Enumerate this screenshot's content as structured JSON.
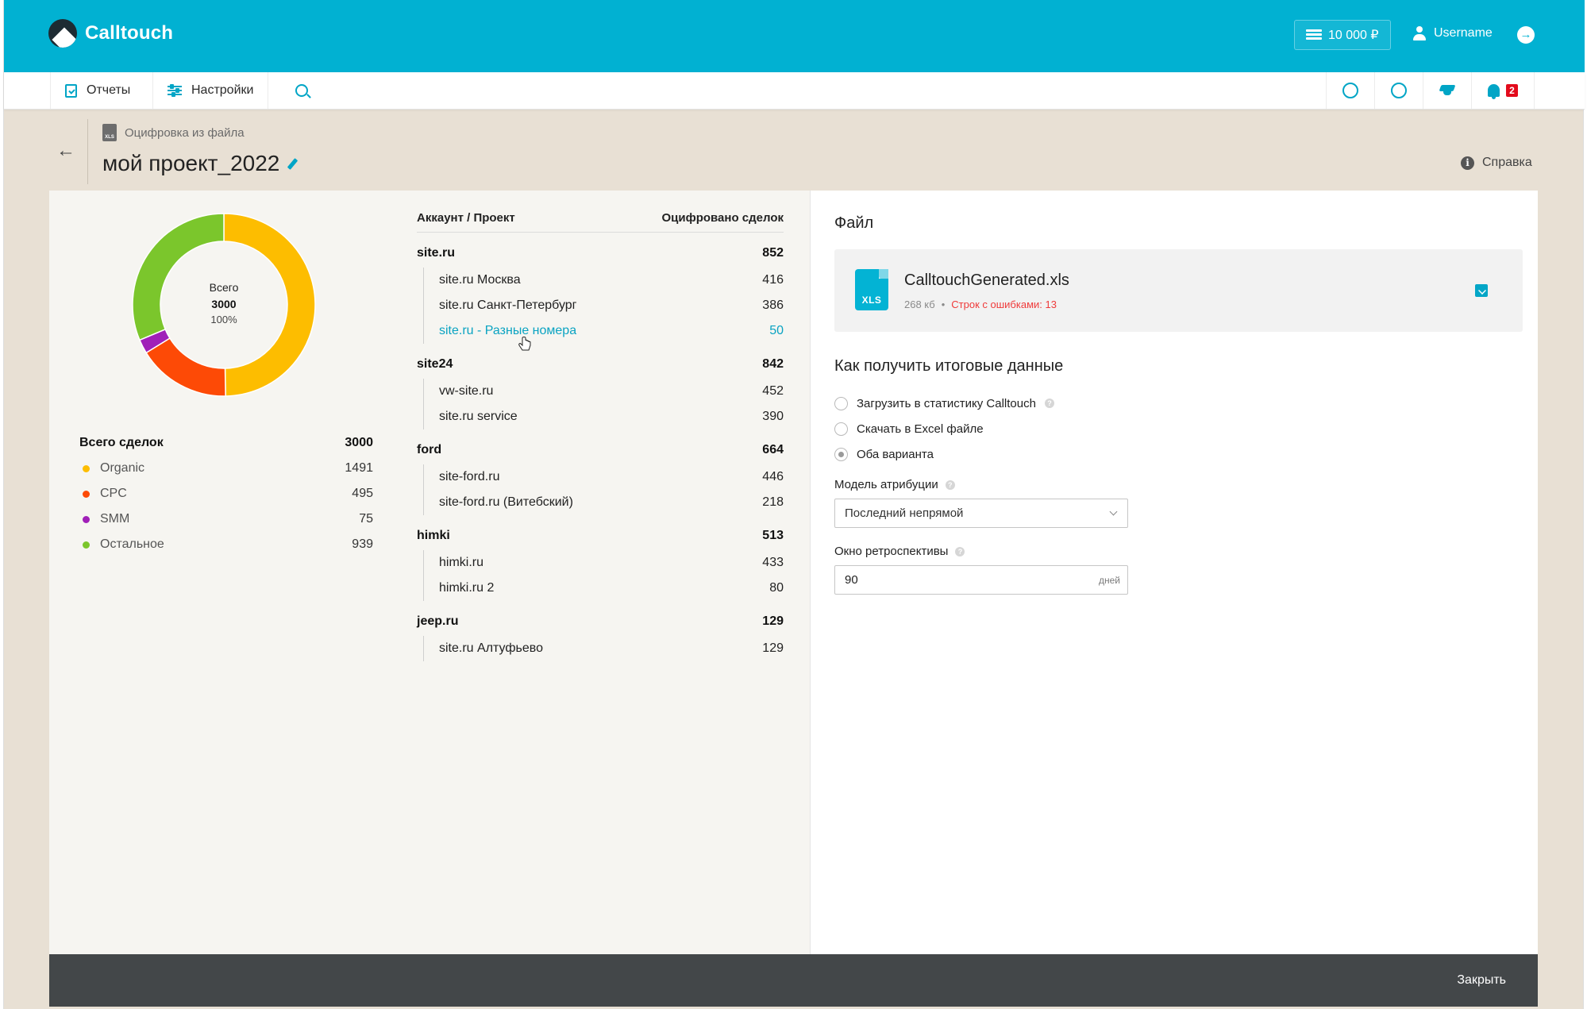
{
  "header": {
    "brand": "Calltouch",
    "balance": "10 000 ₽",
    "username": "Username"
  },
  "nav": {
    "reports": "Отчеты",
    "settings": "Настройки",
    "notifications_count": "2"
  },
  "page": {
    "breadcrumb": "Оцифровка из файла",
    "title": "мой проект_2022",
    "help": "Справка",
    "close": "Закрыть"
  },
  "chart_data": {
    "type": "pie",
    "categories": [
      "Organic",
      "CPC",
      "SMM",
      "Остальное"
    ],
    "values": [
      1491,
      495,
      75,
      939
    ],
    "colors": [
      "#fdbd00",
      "#fd4a06",
      "#a020b8",
      "#7bc62c"
    ],
    "center_label": "Всего",
    "center_value": "3000",
    "center_pct": "100%"
  },
  "summary": {
    "total_label": "Всего сделок",
    "total_value": "3000",
    "items": [
      {
        "label": "Organic",
        "value": "1491",
        "color": "#fdbd00"
      },
      {
        "label": "CPC",
        "value": "495",
        "color": "#fd4a06"
      },
      {
        "label": "SMM",
        "value": "75",
        "color": "#a020b8"
      },
      {
        "label": "Остальное",
        "value": "939",
        "color": "#7bc62c"
      }
    ]
  },
  "table": {
    "col_account": "Аккаунт / Проект",
    "col_count": "Оцифровано сделок",
    "groups": [
      {
        "name": "site.ru",
        "total": "852",
        "rows": [
          {
            "name": "site.ru Москва",
            "value": "416"
          },
          {
            "name": "site.ru Санкт-Петербург",
            "value": "386"
          },
          {
            "name": "site.ru - Разные номера",
            "value": "50"
          }
        ]
      },
      {
        "name": "site24",
        "total": "842",
        "rows": [
          {
            "name": "vw-site.ru",
            "value": "452"
          },
          {
            "name": "site.ru service",
            "value": "390"
          }
        ]
      },
      {
        "name": "ford",
        "total": "664",
        "rows": [
          {
            "name": "site-ford.ru",
            "value": "446"
          },
          {
            "name": "site-ford.ru (Витебский)",
            "value": "218"
          }
        ]
      },
      {
        "name": "himki",
        "total": "513",
        "rows": [
          {
            "name": "himki.ru",
            "value": "433"
          },
          {
            "name": "himki.ru 2",
            "value": "80"
          }
        ]
      },
      {
        "name": "jeep.ru",
        "total": "129",
        "rows": [
          {
            "name": "site.ru Алтуфьево",
            "value": "129"
          }
        ]
      }
    ]
  },
  "file": {
    "section_title": "Файл",
    "name": "CalltouchGenerated.xls",
    "size": "268 кб",
    "errors": "Строк с ошибками: 13",
    "icon_text": "XLS"
  },
  "output": {
    "title": "Как получить итоговые данные",
    "options": [
      {
        "label": "Загрузить в статистику Calltouch",
        "selected": false,
        "help": true
      },
      {
        "label": "Скачать в Excel файле",
        "selected": false,
        "help": false
      },
      {
        "label": "Оба варианта",
        "selected": true,
        "help": false
      }
    ],
    "attribution_label": "Модель атрибуции",
    "attribution_value": "Последний непрямой",
    "lookback_label": "Окно ретроспективы",
    "lookback_value": "90",
    "lookback_unit": "дней"
  }
}
